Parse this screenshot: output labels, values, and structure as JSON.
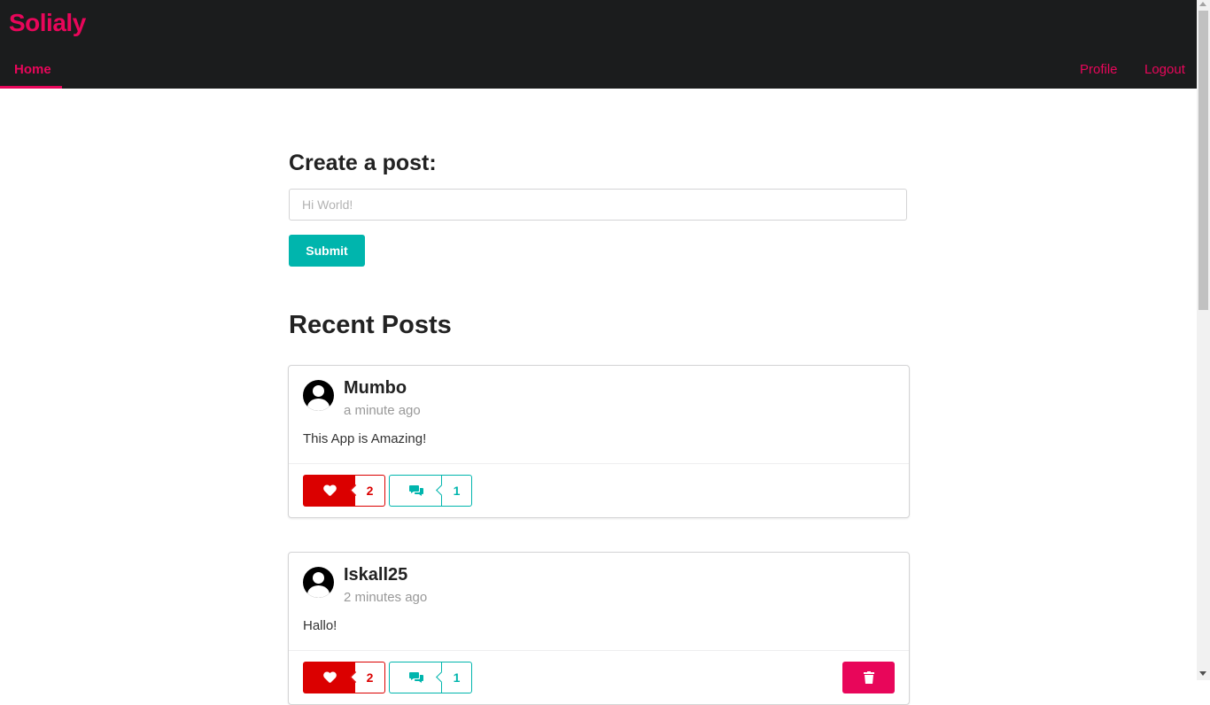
{
  "header": {
    "brand": "Solialy",
    "nav": {
      "home": "Home",
      "profile": "Profile",
      "logout": "Logout"
    }
  },
  "create_post": {
    "title": "Create a post:",
    "input_placeholder": "Hi World!",
    "input_value": "",
    "submit_label": "Submit"
  },
  "recent": {
    "title": "Recent Posts",
    "posts": [
      {
        "author": "Mumbo",
        "time": "a minute ago",
        "content": "This App is Amazing!",
        "likes": "2",
        "comments": "1"
      },
      {
        "author": "Iskall25",
        "time": "2 minutes ago",
        "content": "Hallo!",
        "likes": "2",
        "comments": "1"
      }
    ]
  },
  "colors": {
    "brand": "#e8065a",
    "topbar": "#1b1c1d",
    "teal": "#00b5ad",
    "like_red": "#db0000"
  },
  "icons": [
    "user-avatar-icon",
    "heart-icon",
    "comments-icon",
    "trash-icon"
  ]
}
